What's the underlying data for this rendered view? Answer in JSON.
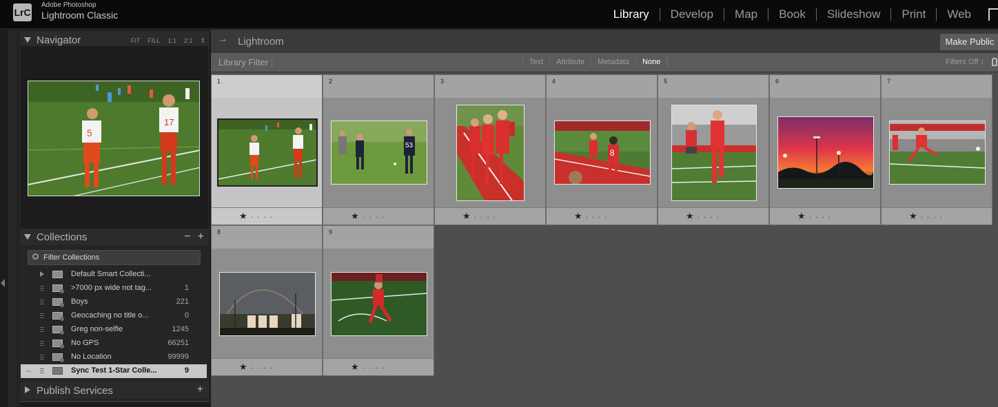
{
  "app": {
    "brand_top": "Adobe Photoshop",
    "brand_name": "Lightroom Classic",
    "logo": "LrC"
  },
  "modules": [
    "Library",
    "Develop",
    "Map",
    "Book",
    "Slideshow",
    "Print",
    "Web"
  ],
  "navigator": {
    "title": "Navigator",
    "options": [
      "FIT",
      "FILL",
      "1:1",
      "2:1"
    ]
  },
  "collections": {
    "title": "Collections",
    "filter_placeholder": "Filter Collections",
    "items": [
      {
        "name": "Default Smart Collecti...",
        "count": ""
      },
      {
        "name": ">7000 px wide not tag...",
        "count": "1"
      },
      {
        "name": "Boys",
        "count": "221"
      },
      {
        "name": "Geocaching no title o...",
        "count": "0"
      },
      {
        "name": "Greg non-selfie",
        "count": "1245"
      },
      {
        "name": "No GPS",
        "count": "66251"
      },
      {
        "name": "No Location",
        "count": "99999"
      },
      {
        "name": "Sync Test 1-Star Colle...",
        "count": "9"
      }
    ]
  },
  "publish": {
    "title": "Publish Services"
  },
  "center": {
    "title": "Lightroom",
    "make_public": "Make Public",
    "filter_label": "Library Filter :",
    "filter_options": [
      "Text",
      "Attribute",
      "Metadata",
      "None"
    ],
    "filters_off": "Filters Off ↕"
  },
  "grid": {
    "cells": [
      {
        "num": "1",
        "rating": 1
      },
      {
        "num": "2",
        "rating": 1
      },
      {
        "num": "3",
        "rating": 1
      },
      {
        "num": "4",
        "rating": 1
      },
      {
        "num": "5",
        "rating": 1
      },
      {
        "num": "6",
        "rating": 1
      },
      {
        "num": "7",
        "rating": 1
      },
      {
        "num": "8",
        "rating": 1
      },
      {
        "num": "9",
        "rating": 1
      }
    ],
    "star": "★",
    "dots": "····"
  }
}
